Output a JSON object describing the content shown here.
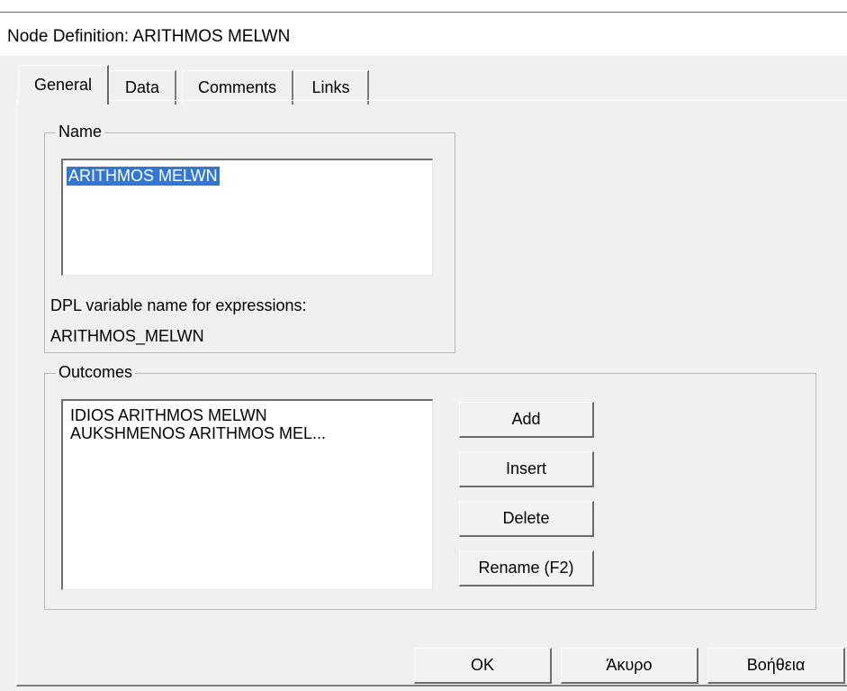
{
  "window": {
    "title": "Node Definition: ARITHMOS MELWN"
  },
  "tabs": [
    {
      "label": "General",
      "active": true
    },
    {
      "label": "Data",
      "active": false
    },
    {
      "label": "Comments",
      "active": false
    },
    {
      "label": "Links",
      "active": false
    }
  ],
  "name_group": {
    "label": "Name",
    "value": "ARITHMOS MELWN",
    "dpl_caption": "DPL variable name for expressions:",
    "dpl_value": "ARITHMOS_MELWN"
  },
  "outcomes_group": {
    "label": "Outcomes",
    "items": [
      "IDIOS ARITHMOS MELWN",
      "AUKSHMENOS ARITHMOS MEL..."
    ],
    "buttons": {
      "add": "Add",
      "insert": "Insert",
      "delete": "Delete",
      "rename": "Rename (F2)"
    }
  },
  "footer": {
    "ok": "OK",
    "cancel": "Άκυρο",
    "help": "Βοήθεια"
  },
  "colors": {
    "title_rule": "#1b83d6",
    "selection": "#3377d4",
    "dialog_bg": "#f0f0f0"
  }
}
